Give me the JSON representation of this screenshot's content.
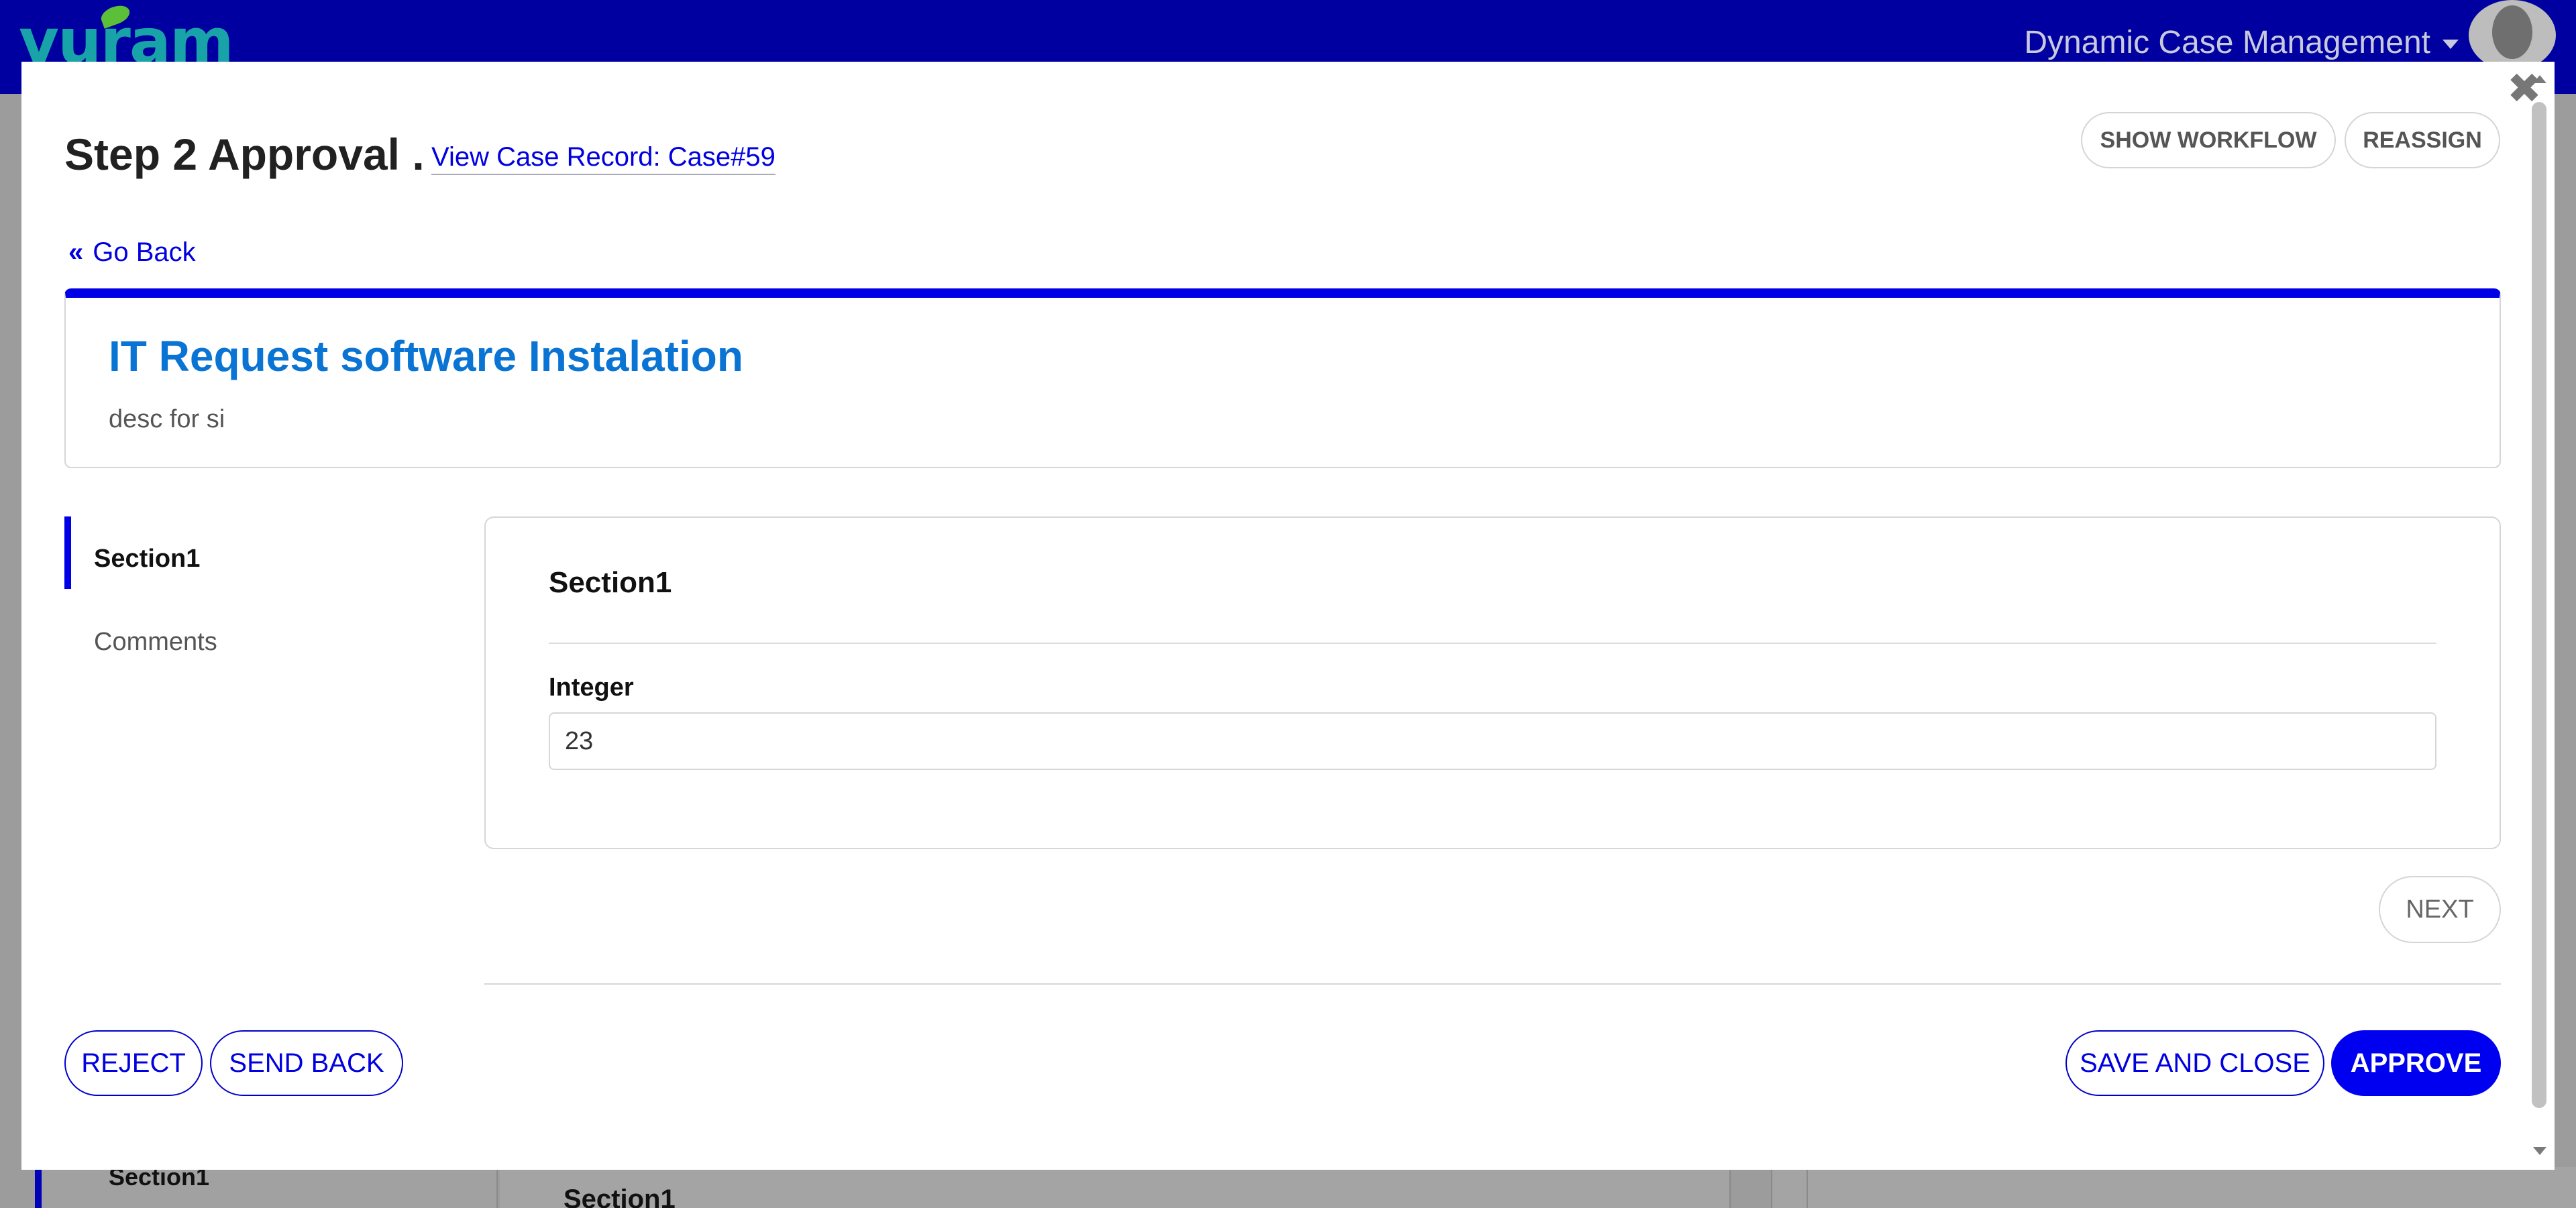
{
  "app": {
    "logo_text": "vuram",
    "title": "Dynamic Case Management"
  },
  "background": {
    "section_label": "Section1",
    "section_title": "Section1"
  },
  "modal": {
    "title": "Step 2 Approval .",
    "case_link": "View Case Record: Case#59",
    "show_workflow": "SHOW WORKFLOW",
    "reassign": "REASSIGN",
    "go_back": "Go Back",
    "go_back_icon": "«",
    "close_icon": "✖"
  },
  "header_card": {
    "title": "IT Request software Instalation",
    "description": "desc for si"
  },
  "sidebar": {
    "items": [
      {
        "label": "Section1",
        "active": true
      },
      {
        "label": "Comments",
        "active": false
      }
    ]
  },
  "section": {
    "title": "Section1",
    "field_label": "Integer",
    "field_value": "23"
  },
  "buttons": {
    "next": "NEXT",
    "reject": "REJECT",
    "send_back": "SEND BACK",
    "save_and_close": "SAVE AND CLOSE",
    "approve": "APPROVE"
  },
  "colors": {
    "topbar": "#0000a0",
    "accent": "#0000e6",
    "header_title": "#0a74d4",
    "approve_bg": "#0000f0"
  }
}
